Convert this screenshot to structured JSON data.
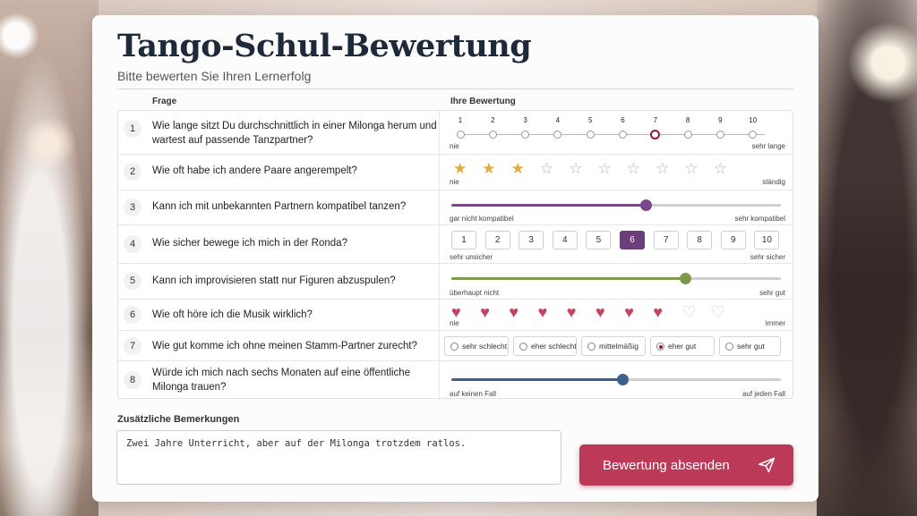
{
  "header": {
    "title": "Tango-Schul-Bewertung",
    "subtitle": "Bitte bewerten Sie Ihren Lernerfolg"
  },
  "columns": {
    "question": "Frage",
    "answer": "Ihre Bewertung"
  },
  "questions": [
    {
      "num": "1",
      "text": "Wie lange sitzt Du durchschnittlich in einer Milonga herum und wartest auf passende Tanzpartner?",
      "type": "scale",
      "points": [
        "1",
        "2",
        "3",
        "4",
        "5",
        "6",
        "7",
        "8",
        "9",
        "10"
      ],
      "selected": 7,
      "min_label": "nie",
      "max_label": "sehr lange"
    },
    {
      "num": "2",
      "text": "Wie oft habe ich andere Paare angerempelt?",
      "type": "stars",
      "max": 10,
      "value": 3,
      "min_label": "nie",
      "max_label": "ständig"
    },
    {
      "num": "3",
      "text": "Kann ich mit unbekannten Partnern kompatibel tanzen?",
      "type": "slider",
      "value_fraction": 0.59,
      "color": "#7a4a86",
      "min_label": "gar nicht kompatibel",
      "max_label": "sehr kompatibel"
    },
    {
      "num": "4",
      "text": "Wie sicher bewege ich mich in der Ronda?",
      "type": "boxes",
      "options": [
        "1",
        "2",
        "3",
        "4",
        "5",
        "6",
        "7",
        "8",
        "9",
        "10"
      ],
      "selected": 6,
      "min_label": "sehr unsicher",
      "max_label": "sehr sicher"
    },
    {
      "num": "5",
      "text": "Kann ich improvisieren statt nur Figuren abzuspulen?",
      "type": "slider",
      "value_fraction": 0.71,
      "color": "#7f9a4c",
      "min_label": "überhaupt nicht",
      "max_label": "sehr gut"
    },
    {
      "num": "6",
      "text": "Wie oft höre ich die Musik wirklich?",
      "type": "hearts",
      "max": 10,
      "value": 8,
      "min_label": "nie",
      "max_label": "immer"
    },
    {
      "num": "7",
      "text": "Wie gut komme ich ohne meinen Stamm-Partner zurecht?",
      "type": "radio",
      "options": [
        "sehr schlecht",
        "eher schlecht",
        "mittelmäßig",
        "eher gut",
        "sehr gut"
      ],
      "selected": 4
    },
    {
      "num": "8",
      "text": "Würde ich mich nach sechs Monaten auf eine öffentliche Milonga trauen?",
      "type": "slider",
      "value_fraction": 0.52,
      "color": "#3f5f8e",
      "min_label": "auf keinen Fall",
      "max_label": "auf jeden Fall"
    }
  ],
  "remarks": {
    "label": "Zusätzliche Bemerkungen",
    "value": "Zwei Jahre Unterricht, aber auf der Milonga trotzdem ratlos."
  },
  "submit": {
    "label": "Bewertung absenden",
    "icon": "send-icon"
  },
  "colors": {
    "accent": "#bc3a58",
    "selected_box": "#6a3f7a",
    "star": "#e4a93a",
    "heart": "#c7445a"
  }
}
